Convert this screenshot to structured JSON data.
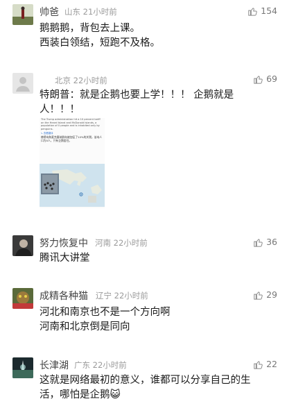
{
  "comments": [
    {
      "username": "帅爸",
      "location": "山东",
      "time": "21小时前",
      "likes": "154",
      "text": "鹅鹅鹅，背包去上课。\n西装白领结，短跑不及格。"
    },
    {
      "username": "",
      "location": "北京",
      "time": "22小时前",
      "likes": "69",
      "text": "特朗普：就是企鹅也要上学！！！ 企鹅就是\n人！！！",
      "embed": {
        "english_text": "The Trump administration hit a 10 percent tariff on the Heard Island and McDonald Islands, a population of 0 people and is inhabited only by penguins.",
        "link_text": "↳ 查看翻译",
        "chinese_text": "赫德岛和麦克唐纳群岛被加征了10%的关税，该岛人口为0人，只有企鹅居住。"
      }
    },
    {
      "username": "努力恢复中",
      "location": "河南",
      "time": "22小时前",
      "likes": "36",
      "text": "腾讯大讲堂"
    },
    {
      "username": "成精各种猫",
      "location": "辽宁",
      "time": "22小时前",
      "likes": "29",
      "text": "河北和南京也不是一个方向啊\n河南和北京倒是同向"
    },
    {
      "username": "长津湖",
      "location": "广东",
      "time": "22小时前",
      "likes": "22",
      "text": "这就是网络最初的意义，谁都可以分享自己的生\n活，哪怕是企鹅😺"
    }
  ],
  "icons": {
    "like": "thumbs-up-icon"
  },
  "colors": {
    "meta": "#9a9a9a",
    "text": "#1a1a1a",
    "username": "#444444"
  }
}
